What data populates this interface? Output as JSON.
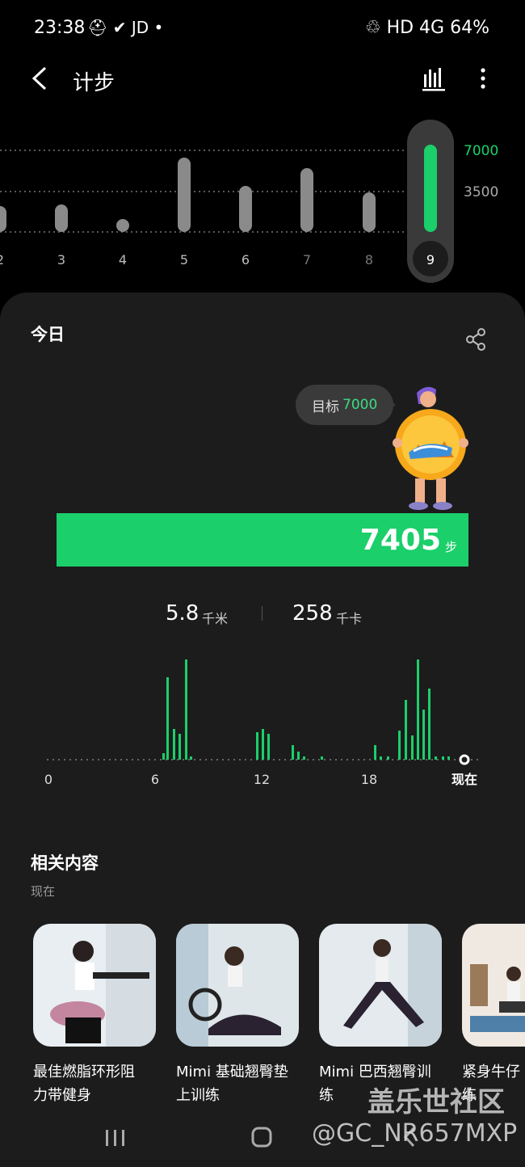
{
  "status_bar": {
    "time": "23:38",
    "left_icons": "⛑ ✔ JD •",
    "right_text": "♲ HD 4G 64%"
  },
  "app_bar": {
    "title": "计步",
    "back_icon": "chevron-left-icon",
    "stats_icon": "bar-chart-icon",
    "more_icon": "more-vertical-icon"
  },
  "week_chart": {
    "guides": [
      "7000",
      "3500"
    ],
    "days": [
      "2",
      "3",
      "4",
      "5",
      "6",
      "7",
      "8",
      "9"
    ],
    "selected": "9"
  },
  "today": {
    "title": "今日",
    "goal_label": "目标",
    "goal_value": "7000",
    "steps": "7405",
    "steps_unit": "步",
    "distance": "5.8",
    "distance_unit": "千米",
    "calories": "258",
    "calories_unit": "千卡"
  },
  "hour_chart": {
    "x_labels": [
      "0",
      "6",
      "12",
      "18",
      "现在"
    ]
  },
  "related": {
    "title": "相关内容",
    "subtitle": "现在",
    "items": [
      {
        "title_line1": "最佳燃脂环形阻",
        "title_line2": "力带健身"
      },
      {
        "title_line1": "Mimi 基础翘臀垫",
        "title_line2": "上训练"
      },
      {
        "title_line1": "Mimi 巴西翘臀训",
        "title_line2": "练"
      },
      {
        "title_line1": "紧身牛仔",
        "title_line2": "练"
      }
    ]
  },
  "watermark": {
    "line1": "盖乐世社区",
    "line2": "@GC_NR657MXP"
  },
  "colors": {
    "accent": "#1bcf6a",
    "card": "#1c1c1c",
    "bar_gray": "#8a8a8a"
  }
}
